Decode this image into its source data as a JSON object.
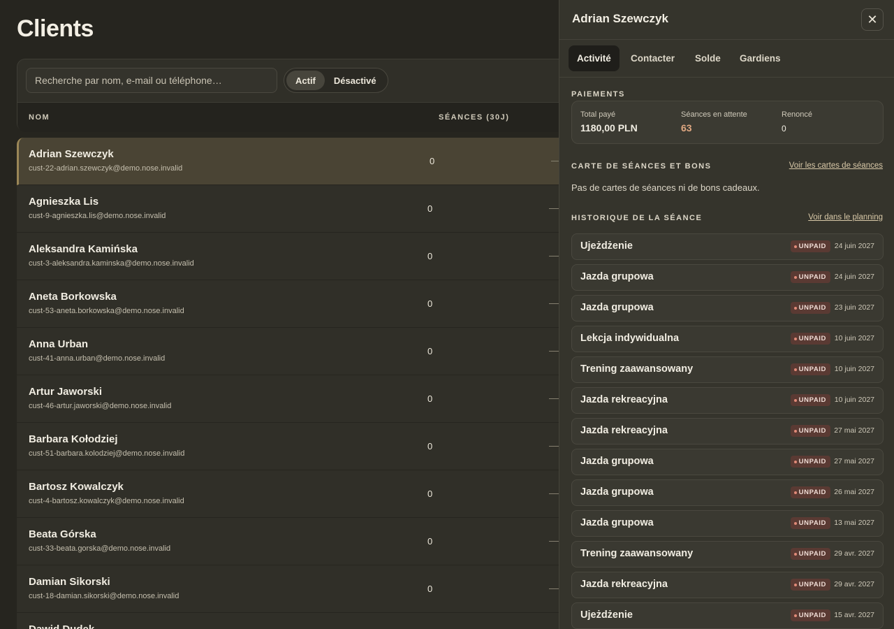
{
  "page": {
    "title": "Clients"
  },
  "search": {
    "placeholder": "Recherche par nom, e-mail ou téléphone…"
  },
  "filter": {
    "active": "Actif",
    "inactive": "Désactivé"
  },
  "table": {
    "col_name": "NOM",
    "col_sessions": "SÉANCES (30J)",
    "rows": [
      {
        "name": "Adrian Szewczyk",
        "email": "cust-22-adrian.szewczyk@demo.nose.invalid",
        "count": "0",
        "dash": "—"
      },
      {
        "name": "Agnieszka Lis",
        "email": "cust-9-agnieszka.lis@demo.nose.invalid",
        "count": "0",
        "dash": "—"
      },
      {
        "name": "Aleksandra Kamińska",
        "email": "cust-3-aleksandra.kaminska@demo.nose.invalid",
        "count": "0",
        "dash": "—"
      },
      {
        "name": "Aneta Borkowska",
        "email": "cust-53-aneta.borkowska@demo.nose.invalid",
        "count": "0",
        "dash": "—"
      },
      {
        "name": "Anna Urban",
        "email": "cust-41-anna.urban@demo.nose.invalid",
        "count": "0",
        "dash": "—"
      },
      {
        "name": "Artur Jaworski",
        "email": "cust-46-artur.jaworski@demo.nose.invalid",
        "count": "0",
        "dash": "—"
      },
      {
        "name": "Barbara Kołodziej",
        "email": "cust-51-barbara.kolodziej@demo.nose.invalid",
        "count": "0",
        "dash": "—"
      },
      {
        "name": "Bartosz Kowalczyk",
        "email": "cust-4-bartosz.kowalczyk@demo.nose.invalid",
        "count": "0",
        "dash": "—"
      },
      {
        "name": "Beata Górska",
        "email": "cust-33-beata.gorska@demo.nose.invalid",
        "count": "0",
        "dash": "—"
      },
      {
        "name": "Damian Sikorski",
        "email": "cust-18-damian.sikorski@demo.nose.invalid",
        "count": "0",
        "dash": "—"
      },
      {
        "name": "Dawid Dudek",
        "email": "",
        "count": "",
        "dash": ""
      }
    ]
  },
  "panel": {
    "title": "Adrian Szewczyk",
    "close": "✕",
    "tabs": [
      "Activité",
      "Contacter",
      "Solde",
      "Gardiens"
    ],
    "payments": {
      "title": "PAIEMENTS",
      "total_label": "Total payé",
      "total_value": "1180,00 PLN",
      "pending_label": "Séances en attente",
      "pending_value": "63",
      "waived_label": "Renoncé",
      "waived_value": "0"
    },
    "cards": {
      "title": "CARTE DE SÉANCES ET BONS",
      "link": "Voir les cartes de séances",
      "empty": "Pas de cartes de séances ni de bons cadeaux."
    },
    "history": {
      "title": "HISTORIQUE DE LA SÉANCE",
      "link": "Voir dans le planning",
      "items": [
        {
          "name": "Ujeżdżenie",
          "status": "UNPAID",
          "date": "24 juin 2027"
        },
        {
          "name": "Jazda grupowa",
          "status": "UNPAID",
          "date": "24 juin 2027"
        },
        {
          "name": "Jazda grupowa",
          "status": "UNPAID",
          "date": "23 juin 2027"
        },
        {
          "name": "Lekcja indywidualna",
          "status": "UNPAID",
          "date": "10 juin 2027"
        },
        {
          "name": "Trening zaawansowany",
          "status": "UNPAID",
          "date": "10 juin 2027"
        },
        {
          "name": "Jazda rekreacyjna",
          "status": "UNPAID",
          "date": "10 juin 2027"
        },
        {
          "name": "Jazda rekreacyjna",
          "status": "UNPAID",
          "date": "27 mai 2027"
        },
        {
          "name": "Jazda grupowa",
          "status": "UNPAID",
          "date": "27 mai 2027"
        },
        {
          "name": "Jazda grupowa",
          "status": "UNPAID",
          "date": "26 mai 2027"
        },
        {
          "name": "Jazda grupowa",
          "status": "UNPAID",
          "date": "13 mai 2027"
        },
        {
          "name": "Trening zaawansowany",
          "status": "UNPAID",
          "date": "29 avr. 2027"
        },
        {
          "name": "Jazda rekreacyjna",
          "status": "UNPAID",
          "date": "29 avr. 2027"
        },
        {
          "name": "Ujeżdżenie",
          "status": "UNPAID",
          "date": "15 avr. 2027"
        }
      ]
    }
  },
  "colors": {
    "background": "#22221d",
    "panel": "#35342c",
    "accent_selected": "#9b8757",
    "pending_orange": "#e0a882",
    "unpaid_badge": "#5a3a33"
  }
}
